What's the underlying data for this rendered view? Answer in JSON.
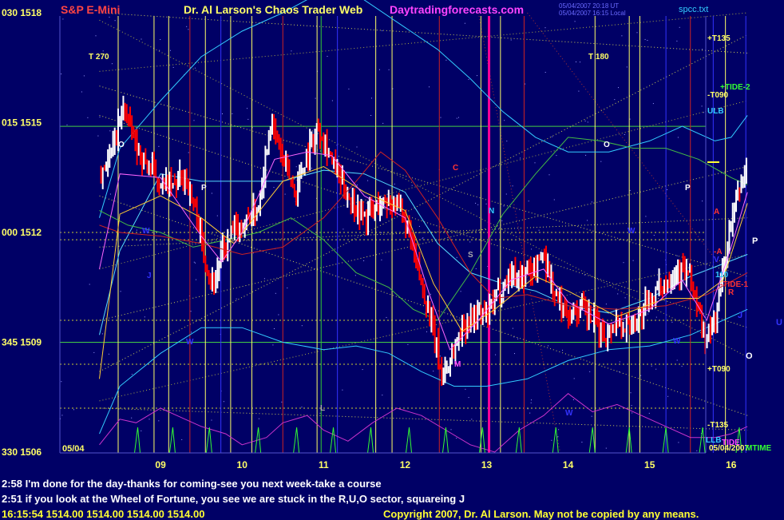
{
  "header": {
    "symbol": "S&P E-Mini",
    "title": "Dr. Al Larson's Chaos Trader Web",
    "site": "Daytradingforecasts.com",
    "timestamp_1": "05/04/2007 20:18 UT",
    "timestamp_2": "05/04/2007 16:15 Local",
    "filename": "spcc.txt"
  },
  "colors": {
    "background": "#000066",
    "up_bar": "#ffffff",
    "down_bar": "#ff0000",
    "vline_yellow": "#ffff66",
    "vline_red": "#cc2222",
    "vline_blue": "#3333ff",
    "vline_green": "#33cc33",
    "vline_magenta": "#ff0099",
    "cyan_band": "#33ccff",
    "magenta_tide": "#cc33cc",
    "spike_green": "#33ff33"
  },
  "chart_data": {
    "type": "candlestick",
    "x_ticks": [
      "09",
      "10",
      "11",
      "12",
      "13",
      "14",
      "15",
      "16"
    ],
    "y_ticks": [
      "030 1518",
      "015 1515",
      "000 1512",
      "345 1509",
      "330 1506"
    ],
    "ylim": [
      1506,
      1518
    ],
    "xlim": [
      8.25,
      16.25
    ],
    "date_label": "05/04",
    "right_labels": [
      "+T135",
      "+TIDE-2",
      "-T090",
      "ULB",
      "A",
      "-A",
      "V",
      "110",
      "-TIDE-1",
      "R",
      "+T090",
      "-T135",
      "LLB",
      "TIDE",
      "05/04/2007",
      "MTIME"
    ],
    "right_margin_letters": [
      "P",
      "J",
      "U",
      "O"
    ],
    "chart_letters": [
      "T 270",
      "T 180",
      "O",
      "O",
      "P",
      "P",
      "C",
      "N",
      "S",
      "M",
      "J",
      "W",
      "W",
      "W",
      "W",
      "W",
      "L"
    ],
    "price_anchors": [
      [
        8.25,
        1513.6
      ],
      [
        8.4,
        1514.2
      ],
      [
        8.55,
        1515.5
      ],
      [
        8.7,
        1514.3
      ],
      [
        8.85,
        1513.8
      ],
      [
        9.0,
        1513.4
      ],
      [
        9.15,
        1513.2
      ],
      [
        9.3,
        1513.6
      ],
      [
        9.45,
        1512.4
      ],
      [
        9.55,
        1511.2
      ],
      [
        9.65,
        1510.6
      ],
      [
        9.75,
        1511.4
      ],
      [
        9.9,
        1512.0
      ],
      [
        10.05,
        1512.3
      ],
      [
        10.2,
        1512.7
      ],
      [
        10.35,
        1515.1
      ],
      [
        10.5,
        1514.0
      ],
      [
        10.65,
        1513.1
      ],
      [
        10.8,
        1514.2
      ],
      [
        10.95,
        1514.9
      ],
      [
        11.05,
        1514.3
      ],
      [
        11.2,
        1513.4
      ],
      [
        11.35,
        1512.9
      ],
      [
        11.5,
        1512.4
      ],
      [
        11.65,
        1512.7
      ],
      [
        11.8,
        1512.9
      ],
      [
        11.95,
        1512.6
      ],
      [
        12.05,
        1511.9
      ],
      [
        12.15,
        1511.0
      ],
      [
        12.25,
        1510.2
      ],
      [
        12.35,
        1509.2
      ],
      [
        12.45,
        1508.1
      ],
      [
        12.55,
        1508.5
      ],
      [
        12.7,
        1509.4
      ],
      [
        12.85,
        1509.8
      ],
      [
        13.0,
        1509.7
      ],
      [
        13.15,
        1510.4
      ],
      [
        13.3,
        1510.9
      ],
      [
        13.45,
        1510.8
      ],
      [
        13.6,
        1511.1
      ],
      [
        13.7,
        1511.4
      ],
      [
        13.85,
        1510.2
      ],
      [
        14.0,
        1509.8
      ],
      [
        14.15,
        1509.9
      ],
      [
        14.3,
        1509.6
      ],
      [
        14.45,
        1509.2
      ],
      [
        14.6,
        1509.6
      ],
      [
        14.75,
        1509.4
      ],
      [
        14.9,
        1509.8
      ],
      [
        15.05,
        1510.3
      ],
      [
        15.2,
        1510.7
      ],
      [
        15.35,
        1511.0
      ],
      [
        15.5,
        1510.8
      ],
      [
        15.6,
        1509.8
      ],
      [
        15.7,
        1509.0
      ],
      [
        15.8,
        1509.6
      ],
      [
        15.9,
        1511.0
      ],
      [
        16.0,
        1512.2
      ],
      [
        16.1,
        1513.2
      ],
      [
        16.2,
        1513.8
      ]
    ],
    "ma_fast": [
      [
        8.25,
        1511.0
      ],
      [
        8.5,
        1513.6
      ],
      [
        9.0,
        1513.5
      ],
      [
        9.5,
        1511.9
      ],
      [
        9.75,
        1511.2
      ],
      [
        10.0,
        1512.0
      ],
      [
        10.4,
        1514.0
      ],
      [
        10.8,
        1514.2
      ],
      [
        11.1,
        1514.1
      ],
      [
        11.5,
        1513.0
      ],
      [
        12.0,
        1512.4
      ],
      [
        12.3,
        1510.3
      ],
      [
        12.55,
        1508.8
      ],
      [
        12.9,
        1509.6
      ],
      [
        13.3,
        1510.7
      ],
      [
        13.7,
        1511.0
      ],
      [
        14.0,
        1510.1
      ],
      [
        14.5,
        1509.5
      ],
      [
        15.0,
        1509.9
      ],
      [
        15.4,
        1510.7
      ],
      [
        15.7,
        1509.6
      ],
      [
        16.0,
        1511.6
      ],
      [
        16.2,
        1513.1
      ]
    ],
    "ma_slow": [
      [
        8.25,
        1508.0
      ],
      [
        8.5,
        1512.5
      ],
      [
        9.0,
        1513.0
      ],
      [
        9.5,
        1512.4
      ],
      [
        9.9,
        1511.7
      ],
      [
        10.5,
        1513.4
      ],
      [
        11.0,
        1513.8
      ],
      [
        11.5,
        1513.1
      ],
      [
        12.0,
        1512.6
      ],
      [
        12.35,
        1510.6
      ],
      [
        12.7,
        1509.3
      ],
      [
        13.1,
        1509.9
      ],
      [
        13.6,
        1510.8
      ],
      [
        14.0,
        1510.4
      ],
      [
        14.6,
        1509.7
      ],
      [
        15.2,
        1510.2
      ],
      [
        15.6,
        1510.2
      ],
      [
        15.9,
        1510.7
      ],
      [
        16.2,
        1512.8
      ]
    ],
    "ma_red": [
      [
        8.25,
        1512.2
      ],
      [
        8.5,
        1512.0
      ],
      [
        9.0,
        1511.9
      ],
      [
        9.5,
        1511.7
      ],
      [
        10.0,
        1511.4
      ],
      [
        10.5,
        1511.6
      ],
      [
        11.0,
        1512.4
      ],
      [
        11.4,
        1513.4
      ],
      [
        11.7,
        1514.2
      ],
      [
        12.0,
        1513.7
      ],
      [
        12.4,
        1512.4
      ],
      [
        12.8,
        1510.9
      ],
      [
        13.1,
        1510.2
      ],
      [
        13.5,
        1510.3
      ],
      [
        14.0,
        1510.0
      ],
      [
        14.6,
        1509.9
      ],
      [
        15.2,
        1510.0
      ],
      [
        15.7,
        1510.3
      ],
      [
        16.2,
        1510.9
      ]
    ],
    "cyan_upper": [
      [
        8.25,
        1512.4
      ],
      [
        8.5,
        1514.3
      ],
      [
        9.0,
        1515.6
      ],
      [
        9.5,
        1516.8
      ],
      [
        10.0,
        1517.5
      ],
      [
        10.5,
        1518.0
      ],
      [
        11.0,
        1518.6
      ],
      [
        11.4,
        1518.5
      ],
      [
        12.0,
        1517.6
      ],
      [
        12.4,
        1517.0
      ],
      [
        12.8,
        1516.2
      ],
      [
        13.2,
        1515.3
      ],
      [
        13.6,
        1514.6
      ],
      [
        14.0,
        1514.2
      ],
      [
        14.5,
        1514.2
      ],
      [
        15.0,
        1514.5
      ],
      [
        15.4,
        1514.9
      ],
      [
        15.8,
        1514.5
      ],
      [
        16.0,
        1514.6
      ],
      [
        16.2,
        1515.2
      ]
    ],
    "cyan_lower": [
      [
        8.25,
        1506.5
      ],
      [
        8.5,
        1507.8
      ],
      [
        9.0,
        1508.7
      ],
      [
        9.5,
        1509.4
      ],
      [
        10.0,
        1509.4
      ],
      [
        10.5,
        1509.0
      ],
      [
        11.0,
        1508.8
      ],
      [
        11.4,
        1508.9
      ],
      [
        11.8,
        1508.7
      ],
      [
        12.2,
        1508.2
      ],
      [
        12.6,
        1507.8
      ],
      [
        13.0,
        1507.8
      ],
      [
        13.5,
        1508.0
      ],
      [
        14.0,
        1508.5
      ],
      [
        14.5,
        1508.8
      ],
      [
        15.0,
        1508.9
      ],
      [
        15.5,
        1509.2
      ],
      [
        16.2,
        1509.9
      ]
    ],
    "cyan_mid": [
      [
        8.25,
        1509.2
      ],
      [
        8.5,
        1511.5
      ],
      [
        9.0,
        1513.6
      ],
      [
        9.5,
        1513.4
      ],
      [
        10.0,
        1513.4
      ],
      [
        10.5,
        1513.4
      ],
      [
        11.0,
        1513.7
      ],
      [
        11.5,
        1513.6
      ],
      [
        12.0,
        1513.1
      ],
      [
        12.4,
        1511.7
      ],
      [
        12.8,
        1510.9
      ],
      [
        13.2,
        1510.6
      ],
      [
        13.6,
        1510.4
      ],
      [
        14.0,
        1510.0
      ],
      [
        14.5,
        1509.8
      ],
      [
        15.0,
        1510.2
      ],
      [
        15.5,
        1510.8
      ],
      [
        16.2,
        1511.4
      ]
    ],
    "green_wave": [
      [
        8.25,
        1512.6
      ],
      [
        8.6,
        1512.2
      ],
      [
        9.0,
        1512.0
      ],
      [
        9.4,
        1511.6
      ],
      [
        9.8,
        1511.8
      ],
      [
        10.2,
        1512.0
      ],
      [
        10.6,
        1512.4
      ],
      [
        11.0,
        1511.8
      ],
      [
        11.4,
        1510.9
      ],
      [
        11.8,
        1510.5
      ],
      [
        12.1,
        1509.9
      ],
      [
        12.4,
        1509.6
      ],
      [
        12.8,
        1510.9
      ],
      [
        13.2,
        1512.5
      ],
      [
        13.6,
        1513.6
      ],
      [
        14.0,
        1514.6
      ],
      [
        14.4,
        1514.5
      ],
      [
        14.8,
        1514.3
      ],
      [
        15.2,
        1514.3
      ],
      [
        15.6,
        1514.0
      ],
      [
        16.0,
        1513.5
      ],
      [
        16.2,
        1513.3
      ]
    ],
    "magenta_tide": [
      [
        8.25,
        1506.2
      ],
      [
        8.5,
        1506.9
      ],
      [
        8.7,
        1506.8
      ],
      [
        9.0,
        1507.2
      ],
      [
        9.2,
        1507.0
      ],
      [
        9.5,
        1506.7
      ],
      [
        9.8,
        1506.5
      ],
      [
        10.0,
        1506.2
      ],
      [
        10.3,
        1506.4
      ],
      [
        10.5,
        1506.8
      ],
      [
        10.8,
        1507.0
      ],
      [
        11.0,
        1506.6
      ],
      [
        11.3,
        1506.3
      ],
      [
        11.6,
        1506.8
      ],
      [
        11.9,
        1507.2
      ],
      [
        12.2,
        1507.0
      ],
      [
        12.5,
        1506.6
      ],
      [
        12.8,
        1506.2
      ],
      [
        13.1,
        1506.0
      ],
      [
        13.4,
        1506.6
      ],
      [
        13.7,
        1507.0
      ],
      [
        14.0,
        1507.6
      ],
      [
        14.3,
        1507.1
      ],
      [
        14.6,
        1507.3
      ],
      [
        14.9,
        1507.0
      ],
      [
        15.2,
        1506.7
      ],
      [
        15.5,
        1506.4
      ],
      [
        15.8,
        1506.4
      ],
      [
        16.0,
        1506.5
      ],
      [
        16.2,
        1506.7
      ]
    ],
    "spikes": [
      8.72,
      9.15,
      9.6,
      10.2,
      10.67,
      11.12,
      11.58,
      12.05,
      12.5,
      12.95,
      13.4,
      13.85,
      14.3,
      14.75,
      15.2,
      15.65,
      16.1
    ],
    "vlines": [
      {
        "x": 8.48,
        "color": "yellow"
      },
      {
        "x": 8.92,
        "color": "yellow"
      },
      {
        "x": 9.1,
        "color": "yellow"
      },
      {
        "x": 9.36,
        "color": "red"
      },
      {
        "x": 9.55,
        "color": "yellow"
      },
      {
        "x": 9.74,
        "color": "blue"
      },
      {
        "x": 9.86,
        "color": "yellow"
      },
      {
        "x": 10.12,
        "color": "yellow"
      },
      {
        "x": 10.5,
        "color": "red"
      },
      {
        "x": 10.92,
        "color": "yellow"
      },
      {
        "x": 10.97,
        "color": "green"
      },
      {
        "x": 11.17,
        "color": "blue"
      },
      {
        "x": 11.64,
        "color": "yellow"
      },
      {
        "x": 11.84,
        "color": "yellow"
      },
      {
        "x": 12.42,
        "color": "red"
      },
      {
        "x": 12.93,
        "color": "yellow"
      },
      {
        "x": 13.03,
        "color": "magenta"
      },
      {
        "x": 13.17,
        "color": "yellow"
      },
      {
        "x": 13.46,
        "color": "red"
      },
      {
        "x": 14.33,
        "color": "yellow"
      },
      {
        "x": 14.75,
        "color": "yellow"
      },
      {
        "x": 14.88,
        "color": "yellow"
      },
      {
        "x": 15.2,
        "color": "blue"
      },
      {
        "x": 15.5,
        "color": "red"
      },
      {
        "x": 15.78,
        "color": "blue"
      },
      {
        "x": 15.93,
        "color": "yellow"
      },
      {
        "x": 16.18,
        "color": "blue"
      }
    ],
    "hlines": [
      1514.9,
      1512.0,
      1511.8,
      1509.6,
      1509.0,
      1508.4,
      1507.2
    ],
    "dotted_diagonals": [
      [
        8.25,
        1517.8,
        16.2,
        1508.6
      ],
      [
        8.25,
        1508.2,
        16.2,
        1517.4
      ],
      [
        8.25,
        1516.0,
        16.2,
        1510.8
      ],
      [
        8.25,
        1511.0,
        16.2,
        1515.6
      ],
      [
        8.25,
        1515.2,
        16.2,
        1509.4
      ],
      [
        8.25,
        1509.6,
        16.2,
        1513.8
      ],
      [
        8.25,
        1507.4,
        16.2,
        1511.4
      ],
      [
        8.25,
        1513.0,
        16.2,
        1507.0
      ],
      [
        8.25,
        1518.0,
        16.2,
        1516.9
      ],
      [
        8.25,
        1516.4,
        16.2,
        1518.0
      ],
      [
        8.25,
        1507.2,
        16.2,
        1506.6
      ],
      [
        8.25,
        1511.6,
        16.2,
        1512.4
      ]
    ]
  },
  "messages": [
    "2:58 I'm done for the day-thanks for coming-see you next week-take a course",
    "2:51 if you look at the Wheel of Fortune, you see we are stuck in the R,U,O sector, squareing J"
  ],
  "footer": {
    "ohlc": "16:15:54  1514.00 1514.00 1514.00 1514.00",
    "copyright": "Copyright 2007, Dr. Al Larson. May not be copied by any means."
  }
}
